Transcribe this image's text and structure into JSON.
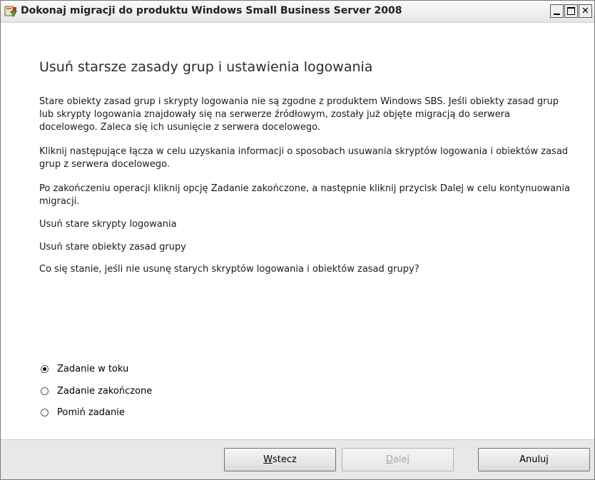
{
  "window": {
    "title": "Dokonaj migracji do produktu Windows Small Business Server 2008"
  },
  "content": {
    "heading": "Usuń starsze zasady grup i ustawienia logowania",
    "paragraphs": [
      "Stare obiekty zasad grup i skrypty logowania nie są zgodne z produktem Windows SBS. Jeśli obiekty zasad grup lub skrypty logowania znajdowały się na serwerze źródłowym, zostały już objęte migracją do serwera docelowego. Zaleca się ich usunięcie z serwera docelowego.",
      "Kliknij następujące łącza w celu uzyskania informacji o sposobach usuwania skryptów logowania i obiektów zasad grup z serwera docelowego.",
      "Po zakończeniu operacji kliknij opcję Zadanie zakończone, a następnie kliknij przycisk Dalej w celu kontynuowania migracji."
    ],
    "links": [
      "Usuń stare skrypty logowania",
      "Usuń stare obiekty zasad grupy",
      "Co się stanie, jeśli nie usunę starych skryptów logowania i obiektów zasad grupy?"
    ]
  },
  "status_options": {
    "selected": "Zadanie w toku",
    "items": [
      "Zadanie w toku",
      "Zadanie zakończone",
      "Pomiń zadanie"
    ]
  },
  "footer": {
    "back": {
      "access_key": "W",
      "rest": "stecz",
      "enabled": true
    },
    "next": {
      "access_key": "D",
      "rest": "alej",
      "enabled": false
    },
    "cancel": {
      "label": "Anuluj",
      "enabled": true
    }
  }
}
